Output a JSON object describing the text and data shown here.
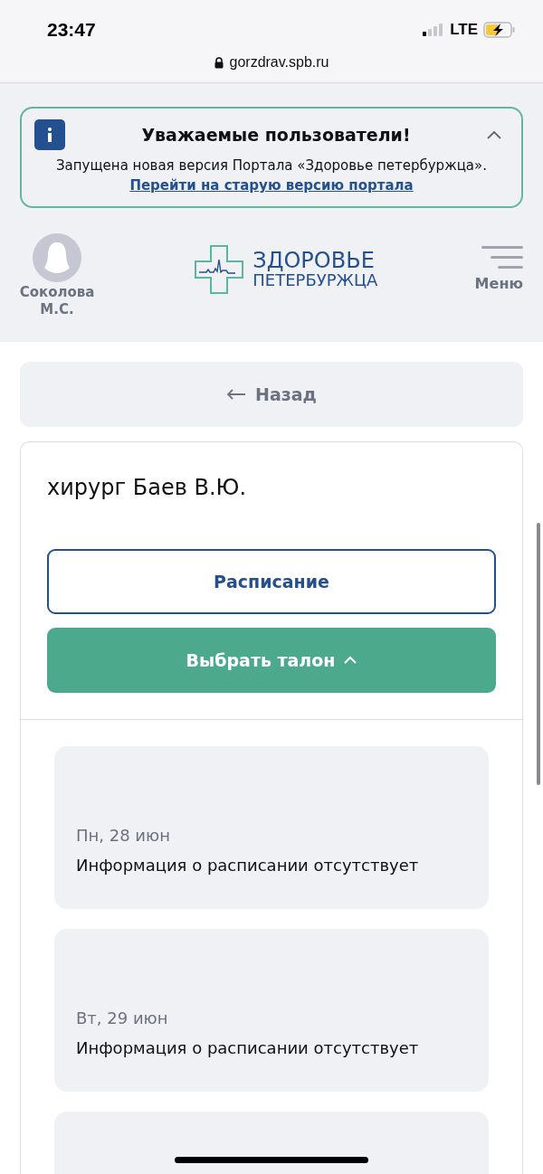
{
  "status_bar": {
    "time": "23:47",
    "network": "LTE"
  },
  "address_bar": {
    "url": "gorzdrav.spb.ru"
  },
  "notice": {
    "title": "Уважаемые пользователи!",
    "expanded": true,
    "text": "Запущена новая версия Портала «Здоровье петербуржца».",
    "link": "Перейти на старую версию портала"
  },
  "header": {
    "user_name": "Соколова М.С.",
    "logo_line_1": "ЗДОРОВЬЕ",
    "logo_line_2": "ПЕТЕРБУРЖЦА",
    "menu_label": "Меню"
  },
  "back_button": {
    "label": "Назад"
  },
  "doctor_card": {
    "title": "хирург Баев В.Ю.",
    "schedule_button": "Расписание",
    "ticket_button": {
      "label": "Выбрать талон",
      "expanded": true
    }
  },
  "days": [
    {
      "date": "Пн, 28 июн",
      "message": "Информация о расписании отсутствует"
    },
    {
      "date": "Вт, 29 июн",
      "message": "Информация о расписании отсутствует"
    }
  ]
}
